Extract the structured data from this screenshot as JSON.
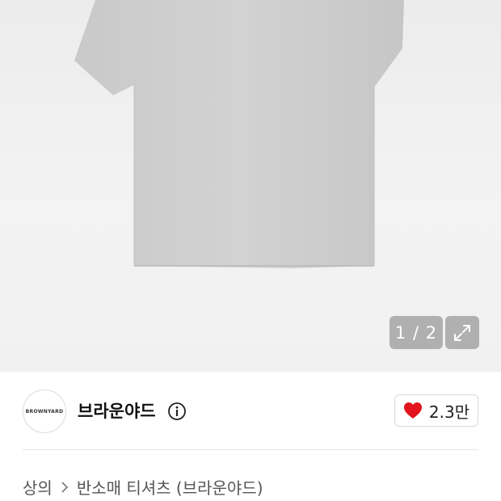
{
  "gallery": {
    "counter": "1 / 2",
    "expand_icon": "expand-icon",
    "product_image": "gray-tshirt"
  },
  "brand": {
    "logo_text": "BROWNYARD",
    "name": "브라운야드",
    "info_icon": "info-icon"
  },
  "like": {
    "icon": "heart-icon",
    "color": "#e3141e",
    "count": "2.3만"
  },
  "breadcrumb": {
    "category": "상의",
    "subcategory": "반소매 티셔츠 (브라운야드)"
  }
}
